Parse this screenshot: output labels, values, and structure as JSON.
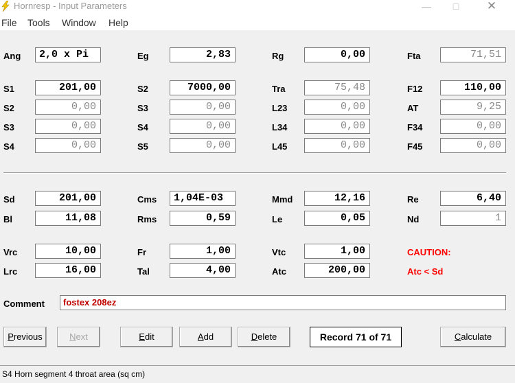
{
  "window": {
    "title": "Hornresp - Input Parameters",
    "minimize": "—",
    "maximize": "□",
    "close": "✕",
    "icon": "lightning-bolt-icon"
  },
  "menu": [
    "File",
    "Tools",
    "Window",
    "Help"
  ],
  "rows": {
    "ang": {
      "label": "Ang",
      "value": "2,0 x Pi"
    },
    "eg": {
      "label": "Eg",
      "value": "2,83"
    },
    "rg": {
      "label": "Rg",
      "value": "0,00"
    },
    "fta": {
      "label": "Fta",
      "value": "71,51"
    },
    "s1": {
      "label": "S1",
      "value": "201,00"
    },
    "s2b": {
      "label": "S2",
      "value": "7000,00"
    },
    "tra": {
      "label": "Tra",
      "value": "75,48"
    },
    "f12": {
      "label": "F12",
      "value": "110,00"
    },
    "s2": {
      "label": "S2",
      "value": "0,00"
    },
    "s3b": {
      "label": "S3",
      "value": "0,00"
    },
    "l23": {
      "label": "L23",
      "value": "0,00"
    },
    "at": {
      "label": "AT",
      "value": "9,25"
    },
    "s3": {
      "label": "S3",
      "value": "0,00"
    },
    "s4b": {
      "label": "S4",
      "value": "0,00"
    },
    "l34": {
      "label": "L34",
      "value": "0,00"
    },
    "f34": {
      "label": "F34",
      "value": "0,00"
    },
    "s4": {
      "label": "S4",
      "value": "0,00"
    },
    "s5": {
      "label": "S5",
      "value": "0,00"
    },
    "l45": {
      "label": "L45",
      "value": "0,00"
    },
    "f45": {
      "label": "F45",
      "value": "0,00"
    },
    "sd": {
      "label": "Sd",
      "value": "201,00"
    },
    "cms": {
      "label": "Cms",
      "value": "1,04E-03"
    },
    "mmd": {
      "label": "Mmd",
      "value": "12,16"
    },
    "re": {
      "label": "Re",
      "value": "6,40"
    },
    "bl": {
      "label": "Bl",
      "value": "11,08"
    },
    "rms": {
      "label": "Rms",
      "value": "0,59"
    },
    "le": {
      "label": "Le",
      "value": "0,05"
    },
    "nd": {
      "label": "Nd",
      "value": "1"
    },
    "vrc": {
      "label": "Vrc",
      "value": "10,00"
    },
    "fr": {
      "label": "Fr",
      "value": "1,00"
    },
    "vtc": {
      "label": "Vtc",
      "value": "1,00"
    },
    "lrc": {
      "label": "Lrc",
      "value": "16,00"
    },
    "tal": {
      "label": "Tal",
      "value": "4,00"
    },
    "atc": {
      "label": "Atc",
      "value": "200,00"
    }
  },
  "caution": {
    "title": "CAUTION:",
    "message": "Atc < Sd",
    "color": "#ff0000"
  },
  "comment": {
    "label": "Comment",
    "value": "fostex 208ez",
    "color": "#c00000"
  },
  "buttons": {
    "previous": {
      "first": "P",
      "rest": "revious"
    },
    "next": {
      "first": "N",
      "rest": "ext"
    },
    "edit": {
      "first": "E",
      "rest": "dit"
    },
    "add": {
      "first": "A",
      "rest": "dd"
    },
    "delete": {
      "first": "D",
      "rest": "elete"
    },
    "calculate": {
      "first": "C",
      "rest": "alculate"
    }
  },
  "record": "Record 71 of 71",
  "status": "S4   Horn segment 4 throat area  (sq cm)"
}
